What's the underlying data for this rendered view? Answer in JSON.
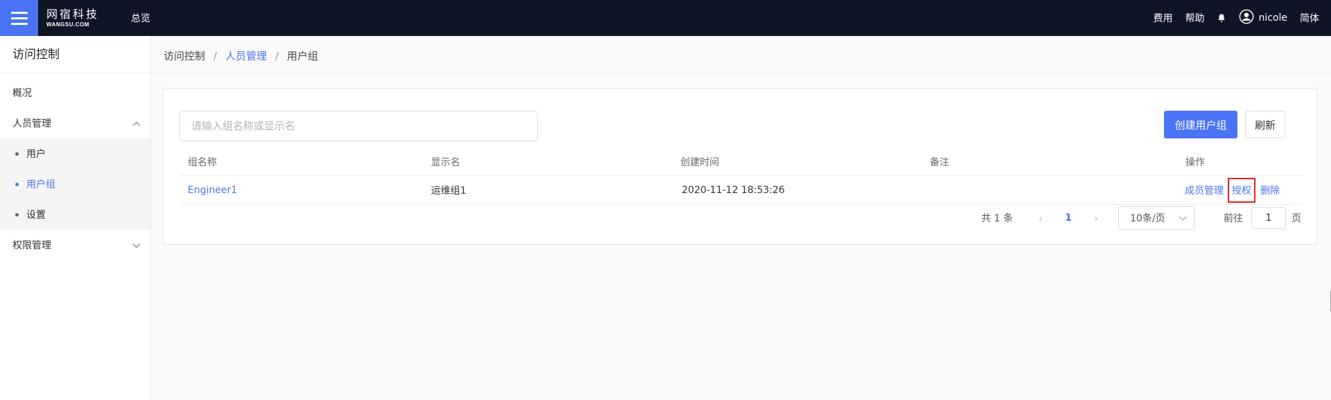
{
  "topbar": {
    "logo_cn": "网宿科技",
    "logo_en": "WANGSU.COM",
    "overview": "总览",
    "fees": "费用",
    "help": "帮助",
    "username": "nicole",
    "language": "简体"
  },
  "sidebar": {
    "title": "访问控制",
    "overview": "概况",
    "people_mgmt": "人员管理",
    "sub_items": [
      "用户",
      "用户组",
      "设置"
    ],
    "permission_mgmt": "权限管理"
  },
  "breadcrumb": {
    "root": "访问控制",
    "middle": "人员管理",
    "current": "用户组",
    "separator": "/"
  },
  "toolbar": {
    "search_placeholder": "请输入组名称或显示名",
    "create_label": "创建用户组",
    "refresh_label": "刷新"
  },
  "table": {
    "headers": [
      "组名称",
      "显示名",
      "创建时间",
      "备注",
      "操作"
    ],
    "rows": [
      {
        "name": "Engineer1",
        "display_name": "运维组1",
        "created": "2020-11-12 18:53:26",
        "remark": "",
        "actions": [
          "成员管理",
          "授权",
          "删除"
        ]
      }
    ]
  },
  "pagination": {
    "total_text": "共 1 条",
    "current_page": "1",
    "page_size": "10条/页",
    "goto_prefix": "前往",
    "goto_value": "1",
    "goto_suffix": "页",
    "prev": "‹",
    "next": "›"
  },
  "colors": {
    "accent": "#4a74f5",
    "topbar": "#0f1524",
    "highlight_box": "#e02020"
  }
}
